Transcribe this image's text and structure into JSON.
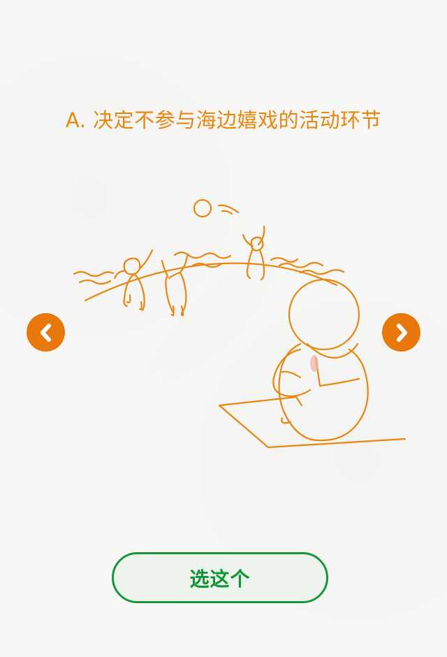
{
  "question": {
    "title": "A. 决定不参与海边嬉戏的活动环节"
  },
  "illustration": {
    "icon": "beach-scene-illustration",
    "stroke_color": "#e8860f"
  },
  "navigation": {
    "prev_icon": "chevron-left-icon",
    "next_icon": "chevron-right-icon",
    "button_color": "#e8780c"
  },
  "action": {
    "select_label": "选这个",
    "border_color": "#16963a",
    "text_color": "#0f9633"
  }
}
